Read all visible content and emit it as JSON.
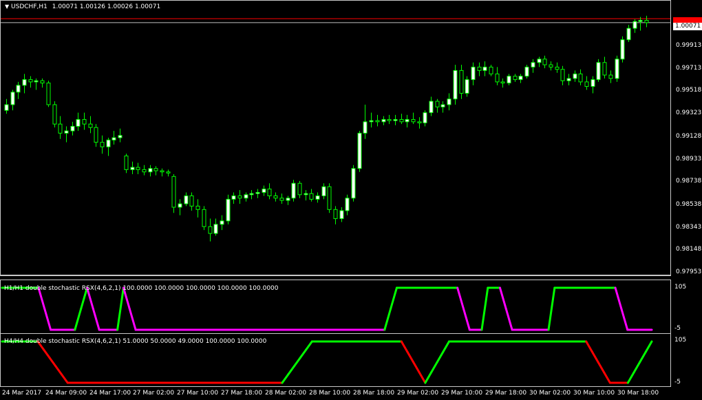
{
  "header": {
    "menu_icon": "triangle-down-icon",
    "symbol": "USDCHF,H1",
    "ohlc": "1.00071 1.00126 1.00026 1.00071"
  },
  "price_scale": {
    "labels": [
      "0.99913",
      "0.99713",
      "0.99518",
      "0.99323",
      "0.99128",
      "0.98933",
      "0.98738",
      "0.98538",
      "0.98343",
      "0.98148",
      "0.97953"
    ],
    "current_price": "1.00071",
    "ask_price": "1.00105"
  },
  "indicators": [
    {
      "title": "H1/H1 double stochastic RSX(4,6,2,1) 100.0000 100.0000 100.0000 100.0000 100.0000",
      "top": "105",
      "bottom": "-5"
    },
    {
      "title": "H4/H4 double stochastic RSX(4,6,2,1) 51.0000 50.0000 49.0000 100.0000 100.0000",
      "top": "105",
      "bottom": "-5"
    }
  ],
  "time_axis": [
    "24 Mar 2017",
    "24 Mar 09:00",
    "24 Mar 17:00",
    "27 Mar 02:00",
    "27 Mar 10:00",
    "27 Mar 18:00",
    "28 Mar 02:00",
    "28 Mar 10:00",
    "28 Mar 18:00",
    "29 Mar 02:00",
    "29 Mar 10:00",
    "29 Mar 18:00",
    "30 Mar 02:00",
    "30 Mar 10:00",
    "30 Mar 18:00"
  ],
  "colors": {
    "background": "#000000",
    "bull_body": "#ffffff",
    "bear_body": "#000000",
    "wick": "#00ff00",
    "stoch_up": "#00ff00",
    "stoch_down_h1": "#ff00ff",
    "stoch_down_h4": "#ff0000",
    "ask_line": "#ff0000",
    "bid_line": "#c0c0c0"
  },
  "chart_data": [
    {
      "type": "candlestick",
      "title": "USDCHF,H1",
      "ylim": [
        0.9787,
        1.0019
      ],
      "candles": [
        [
          0.993,
          0.994,
          0.9927,
          0.9935
        ],
        [
          0.9935,
          0.9948,
          0.993,
          0.9946
        ],
        [
          0.9946,
          0.9955,
          0.994,
          0.9952
        ],
        [
          0.9952,
          0.9962,
          0.9945,
          0.9957
        ],
        [
          0.9957,
          0.996,
          0.995,
          0.9955
        ],
        [
          0.9955,
          0.9958,
          0.9948,
          0.9956
        ],
        [
          0.9956,
          0.9958,
          0.995,
          0.9954
        ],
        [
          0.9954,
          0.9956,
          0.9933,
          0.9935
        ],
        [
          0.9935,
          0.9938,
          0.9915,
          0.9918
        ],
        [
          0.9918,
          0.9925,
          0.9905,
          0.991
        ],
        [
          0.991,
          0.9916,
          0.9902,
          0.9912
        ],
        [
          0.9912,
          0.992,
          0.9908,
          0.9916
        ],
        [
          0.9916,
          0.9928,
          0.9912,
          0.9922
        ],
        [
          0.9922,
          0.9928,
          0.9913,
          0.9918
        ],
        [
          0.9918,
          0.9925,
          0.991,
          0.9915
        ],
        [
          0.9915,
          0.9918,
          0.9898,
          0.9902
        ],
        [
          0.9902,
          0.9908,
          0.9892,
          0.9898
        ],
        [
          0.9898,
          0.9906,
          0.989,
          0.9904
        ],
        [
          0.9904,
          0.9912,
          0.99,
          0.9906
        ],
        [
          0.9906,
          0.9914,
          0.9902,
          0.9908
        ],
        [
          0.989,
          0.9892,
          0.9875,
          0.9878
        ],
        [
          0.9878,
          0.9885,
          0.9874,
          0.988
        ],
        [
          0.988,
          0.9884,
          0.9874,
          0.9878
        ],
        [
          0.9878,
          0.9882,
          0.9873,
          0.9876
        ],
        [
          0.9876,
          0.9882,
          0.9872,
          0.9879
        ],
        [
          0.9879,
          0.9881,
          0.9873,
          0.9877
        ],
        [
          0.9877,
          0.9879,
          0.9872,
          0.9876
        ],
        [
          0.9876,
          0.9878,
          0.9872,
          0.9875
        ],
        [
          0.9872,
          0.9874,
          0.984,
          0.9845
        ],
        [
          0.9845,
          0.9852,
          0.9838,
          0.9848
        ],
        [
          0.9848,
          0.9858,
          0.9846,
          0.9855
        ],
        [
          0.9855,
          0.9858,
          0.9842,
          0.9846
        ],
        [
          0.9846,
          0.9852,
          0.9836,
          0.9843
        ],
        [
          0.9843,
          0.9846,
          0.9825,
          0.9828
        ],
        [
          0.9828,
          0.9835,
          0.9815,
          0.9822
        ],
        [
          0.9822,
          0.9835,
          0.982,
          0.983
        ],
        [
          0.983,
          0.9838,
          0.9825,
          0.9833
        ],
        [
          0.9833,
          0.9856,
          0.983,
          0.9852
        ],
        [
          0.9852,
          0.9858,
          0.9848,
          0.9855
        ],
        [
          0.9855,
          0.986,
          0.9848,
          0.9853
        ],
        [
          0.9853,
          0.9858,
          0.985,
          0.9856
        ],
        [
          0.9856,
          0.986,
          0.9852,
          0.9857
        ],
        [
          0.9857,
          0.9861,
          0.9853,
          0.9858
        ],
        [
          0.9858,
          0.9864,
          0.9855,
          0.9861
        ],
        [
          0.9861,
          0.9866,
          0.9852,
          0.9855
        ],
        [
          0.9855,
          0.9858,
          0.985,
          0.9853
        ],
        [
          0.9853,
          0.9857,
          0.9848,
          0.9851
        ],
        [
          0.9851,
          0.9855,
          0.9847,
          0.9853
        ],
        [
          0.9853,
          0.9869,
          0.985,
          0.9866
        ],
        [
          0.9866,
          0.9868,
          0.9853,
          0.9856
        ],
        [
          0.9856,
          0.986,
          0.9851,
          0.9857
        ],
        [
          0.9857,
          0.9861,
          0.985,
          0.9852
        ],
        [
          0.9852,
          0.9858,
          0.9849,
          0.9855
        ],
        [
          0.9855,
          0.9866,
          0.9852,
          0.9863
        ],
        [
          0.9863,
          0.9866,
          0.984,
          0.9843
        ],
        [
          0.9843,
          0.9846,
          0.983,
          0.9835
        ],
        [
          0.9835,
          0.9845,
          0.9832,
          0.9842
        ],
        [
          0.9842,
          0.9856,
          0.9838,
          0.9853
        ],
        [
          0.9853,
          0.9882,
          0.985,
          0.9879
        ],
        [
          0.9879,
          0.9912,
          0.9876,
          0.991
        ],
        [
          0.991,
          0.9935,
          0.9905,
          0.992
        ],
        [
          0.992,
          0.9928,
          0.9915,
          0.9921
        ],
        [
          0.9921,
          0.9926,
          0.9916,
          0.992
        ],
        [
          0.992,
          0.9925,
          0.9917,
          0.9922
        ],
        [
          0.9922,
          0.9926,
          0.9918,
          0.9921
        ],
        [
          0.9921,
          0.9926,
          0.9917,
          0.9922
        ],
        [
          0.9922,
          0.9927,
          0.9918,
          0.992
        ],
        [
          0.992,
          0.9926,
          0.9915,
          0.9922
        ],
        [
          0.9922,
          0.9928,
          0.9918,
          0.992
        ],
        [
          0.992,
          0.9924,
          0.9914,
          0.9919
        ],
        [
          0.9919,
          0.993,
          0.9916,
          0.9928
        ],
        [
          0.9928,
          0.9942,
          0.9925,
          0.9938
        ],
        [
          0.9938,
          0.994,
          0.9928,
          0.9933
        ],
        [
          0.9933,
          0.9938,
          0.9928,
          0.9935
        ],
        [
          0.9935,
          0.9945,
          0.993,
          0.994
        ],
        [
          0.994,
          0.997,
          0.9935,
          0.9965
        ],
        [
          0.9965,
          0.997,
          0.994,
          0.9945
        ],
        [
          0.9945,
          0.996,
          0.9942,
          0.9957
        ],
        [
          0.9957,
          0.9972,
          0.9952,
          0.9968
        ],
        [
          0.9968,
          0.9972,
          0.996,
          0.9965
        ],
        [
          0.9965,
          0.9973,
          0.996,
          0.9968
        ],
        [
          0.9968,
          0.997,
          0.996,
          0.9962
        ],
        [
          0.9962,
          0.9968,
          0.9952,
          0.9955
        ],
        [
          0.9955,
          0.9958,
          0.995,
          0.9954
        ],
        [
          0.9954,
          0.9962,
          0.9952,
          0.996
        ],
        [
          0.996,
          0.9962,
          0.9955,
          0.9957
        ],
        [
          0.9957,
          0.9962,
          0.9954,
          0.996
        ],
        [
          0.996,
          0.997,
          0.9958,
          0.9968
        ],
        [
          0.9968,
          0.9975,
          0.9963,
          0.9972
        ],
        [
          0.9972,
          0.9977,
          0.9968,
          0.9975
        ],
        [
          0.9975,
          0.9978,
          0.9967,
          0.997
        ],
        [
          0.997,
          0.9973,
          0.9965,
          0.9968
        ],
        [
          0.9968,
          0.9972,
          0.9963,
          0.9966
        ],
        [
          0.9966,
          0.9969,
          0.9952,
          0.9956
        ],
        [
          0.9956,
          0.9962,
          0.9952,
          0.9958
        ],
        [
          0.9958,
          0.9965,
          0.9955,
          0.9962
        ],
        [
          0.9962,
          0.9966,
          0.9952,
          0.9955
        ],
        [
          0.9955,
          0.996,
          0.9948,
          0.9951
        ],
        [
          0.9951,
          0.996,
          0.9945,
          0.9957
        ],
        [
          0.9957,
          0.9975,
          0.9955,
          0.9972
        ],
        [
          0.9972,
          0.9977,
          0.9958,
          0.9961
        ],
        [
          0.9961,
          0.9965,
          0.9954,
          0.9958
        ],
        [
          0.9958,
          0.9978,
          0.9955,
          0.9975
        ],
        [
          0.9975,
          0.9995,
          0.9972,
          0.9992
        ],
        [
          0.9992,
          1.0005,
          0.999,
          1.0002
        ],
        [
          1.0002,
          1.001,
          0.9998,
          1.0008
        ],
        [
          1.0008,
          1.0012,
          1.0,
          1.0009
        ],
        [
          1.0009,
          1.0013,
          1.0003,
          1.0007
        ]
      ]
    },
    {
      "type": "line",
      "title": "H1/H1 double stochastic RSX(4,6,2,1)",
      "ylim": [
        -5,
        105
      ],
      "series": [
        {
          "values": [
            100,
            100,
            100,
            100,
            100,
            100,
            100,
            100,
            100,
            100,
            100,
            100,
            100,
            100,
            100,
            100,
            100,
            100,
            100,
            100,
            100,
            100,
            100,
            100,
            100,
            100,
            100,
            100,
            100,
            100,
            100,
            100,
            100,
            100,
            100,
            100,
            100,
            100,
            100,
            100,
            100,
            100,
            100,
            100,
            100,
            100,
            100,
            100,
            100,
            100,
            100,
            100,
            100,
            100,
            100,
            100,
            100,
            100,
            100,
            100,
            100,
            100,
            100,
            100,
            100,
            100,
            100,
            100,
            100,
            100,
            100,
            100,
            100,
            100,
            100,
            100,
            100,
            100,
            100,
            100,
            100,
            100,
            100,
            100,
            100,
            100,
            100,
            100,
            100,
            100,
            100,
            100,
            100,
            100,
            100,
            100,
            100,
            100,
            100,
            100,
            100,
            100,
            100,
            100,
            100,
            100,
            100,
            100
          ]
        },
        {
          "values": [
            100,
            100,
            100,
            100,
            100,
            100,
            100,
            50,
            0,
            0,
            0,
            0,
            0,
            50,
            100,
            50,
            0,
            0,
            0,
            0,
            100,
            50,
            0,
            0,
            0,
            0,
            0,
            0,
            0,
            0,
            0,
            0,
            0,
            0,
            0,
            0,
            0,
            0,
            0,
            0,
            0,
            0,
            0,
            0,
            0,
            0,
            0,
            0,
            0,
            0,
            0,
            0,
            0,
            0,
            0,
            0,
            0,
            0,
            0,
            0,
            0,
            0,
            0,
            0,
            50,
            100,
            100,
            100,
            100,
            100,
            100,
            100,
            100,
            100,
            100,
            100,
            50,
            0,
            0,
            0,
            100,
            100,
            100,
            50,
            0,
            0,
            0,
            0,
            0,
            0,
            0,
            100,
            100,
            100,
            100,
            100,
            100,
            100,
            100,
            100,
            100,
            100,
            50,
            0,
            0,
            0,
            0,
            0,
            100
          ]
        }
      ]
    },
    {
      "type": "line",
      "title": "H4/H4 double stochastic RSX(4,6,2,1)",
      "ylim": [
        -5,
        105
      ],
      "series": [
        {
          "values": [
            100,
            100,
            100,
            100,
            100,
            100,
            100,
            80,
            60,
            40,
            20,
            0,
            0,
            0,
            0,
            0,
            0,
            0,
            0,
            0,
            0,
            0,
            0,
            0,
            0,
            0,
            0,
            0,
            0,
            0,
            0,
            0,
            0,
            0,
            0,
            0,
            0,
            0,
            0,
            0,
            0,
            0,
            0,
            0,
            0,
            0,
            0,
            0,
            20,
            40,
            60,
            80,
            100,
            100,
            100,
            100,
            100,
            100,
            100,
            100,
            100,
            100,
            100,
            100,
            100,
            100,
            100,
            100,
            75,
            50,
            25,
            0,
            25,
            50,
            75,
            100,
            100,
            100,
            100,
            100,
            100,
            100,
            100,
            100,
            100,
            100,
            100,
            100,
            100,
            100,
            100,
            100,
            100,
            100,
            100,
            100,
            100,
            100,
            100,
            75,
            50,
            25,
            0,
            0,
            0,
            0,
            25,
            50,
            75,
            100
          ]
        }
      ]
    }
  ]
}
